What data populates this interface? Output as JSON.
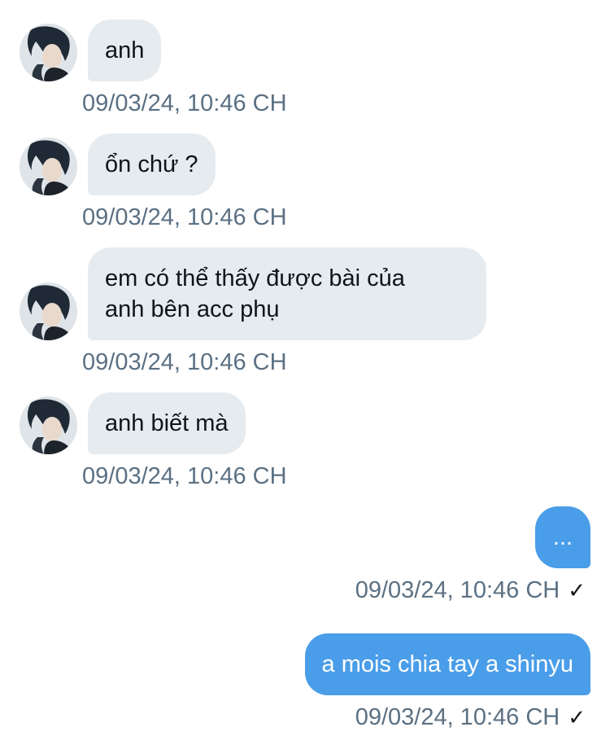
{
  "conversation": {
    "incoming": [
      {
        "text": "anh",
        "time": "09/03/24, 10:46 CH"
      },
      {
        "text": "ổn chứ ?",
        "time": "09/03/24, 10:46 CH"
      },
      {
        "text": "em có thể thấy được bài của anh bên acc phụ",
        "line1": "em có thể thấy được bài của",
        "line2": "anh bên acc phụ",
        "time": "09/03/24, 10:46 CH"
      },
      {
        "text": "anh biết mà",
        "time": "09/03/24, 10:46 CH"
      }
    ],
    "outgoing": [
      {
        "text": "...",
        "time": "09/03/24, 10:46 CH",
        "status": "✓"
      },
      {
        "text": "a mois chia tay a shinyu",
        "time": "09/03/24, 10:46 CH",
        "status": "✓"
      }
    ]
  },
  "colors": {
    "incoming_bubble": "#e6ebef",
    "outgoing_bubble": "#4a9de8",
    "timestamp": "#5b7083"
  },
  "icons": {
    "avatar": "user-avatar-photo",
    "read_status": "checkmark-icon"
  }
}
